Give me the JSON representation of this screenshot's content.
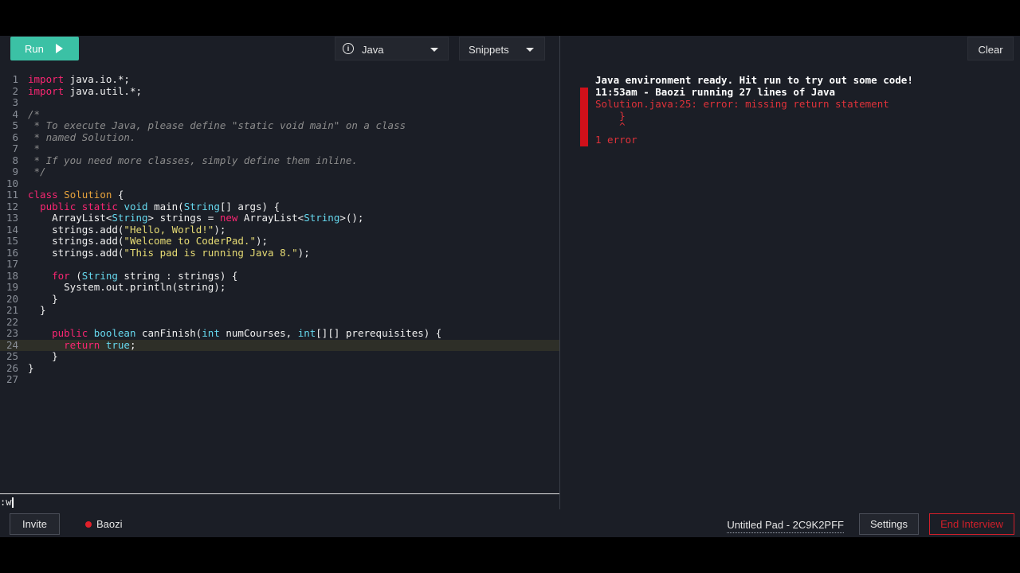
{
  "toolbar": {
    "run_label": "Run",
    "language_label": "Java",
    "snippets_label": "Snippets",
    "clear_label": "Clear"
  },
  "editor": {
    "lines": [
      {
        "n": "1",
        "tokens": [
          {
            "t": "import",
            "c": "kw"
          },
          {
            "t": " java.io.*;"
          }
        ]
      },
      {
        "n": "2",
        "tokens": [
          {
            "t": "import",
            "c": "kw"
          },
          {
            "t": " java.util.*;"
          }
        ]
      },
      {
        "n": "3",
        "tokens": []
      },
      {
        "n": "4",
        "tokens": [
          {
            "t": "/*",
            "c": "cm"
          }
        ]
      },
      {
        "n": "5",
        "tokens": [
          {
            "t": " * To execute Java, please define \"static void main\" on a class",
            "c": "cm"
          }
        ]
      },
      {
        "n": "6",
        "tokens": [
          {
            "t": " * named Solution.",
            "c": "cm"
          }
        ]
      },
      {
        "n": "7",
        "tokens": [
          {
            "t": " *",
            "c": "cm"
          }
        ]
      },
      {
        "n": "8",
        "tokens": [
          {
            "t": " * If you need more classes, simply define them inline.",
            "c": "cm"
          }
        ]
      },
      {
        "n": "9",
        "tokens": [
          {
            "t": " */",
            "c": "cm"
          }
        ]
      },
      {
        "n": "10",
        "tokens": []
      },
      {
        "n": "11",
        "tokens": [
          {
            "t": "class",
            "c": "kw"
          },
          {
            "t": " "
          },
          {
            "t": "Solution",
            "c": "cls"
          },
          {
            "t": " {"
          }
        ]
      },
      {
        "n": "12",
        "tokens": [
          {
            "t": "  "
          },
          {
            "t": "public static",
            "c": "kw"
          },
          {
            "t": " "
          },
          {
            "t": "void",
            "c": "ty"
          },
          {
            "t": " main("
          },
          {
            "t": "String",
            "c": "ty"
          },
          {
            "t": "[] args) {"
          }
        ]
      },
      {
        "n": "13",
        "tokens": [
          {
            "t": "    ArrayList<"
          },
          {
            "t": "String",
            "c": "ty"
          },
          {
            "t": "> strings = "
          },
          {
            "t": "new",
            "c": "kw"
          },
          {
            "t": " ArrayList<"
          },
          {
            "t": "String",
            "c": "ty"
          },
          {
            "t": ">();"
          }
        ]
      },
      {
        "n": "14",
        "tokens": [
          {
            "t": "    strings.add("
          },
          {
            "t": "\"Hello, World!\"",
            "c": "str"
          },
          {
            "t": ");"
          }
        ]
      },
      {
        "n": "15",
        "tokens": [
          {
            "t": "    strings.add("
          },
          {
            "t": "\"Welcome to CoderPad.\"",
            "c": "str"
          },
          {
            "t": ");"
          }
        ]
      },
      {
        "n": "16",
        "tokens": [
          {
            "t": "    strings.add("
          },
          {
            "t": "\"This pad is running Java 8.\"",
            "c": "str"
          },
          {
            "t": ");"
          }
        ]
      },
      {
        "n": "17",
        "tokens": []
      },
      {
        "n": "18",
        "tokens": [
          {
            "t": "    "
          },
          {
            "t": "for",
            "c": "kw"
          },
          {
            "t": " ("
          },
          {
            "t": "String",
            "c": "ty"
          },
          {
            "t": " string : strings) {"
          }
        ]
      },
      {
        "n": "19",
        "tokens": [
          {
            "t": "      System.out.println(string);"
          }
        ]
      },
      {
        "n": "20",
        "tokens": [
          {
            "t": "    }"
          }
        ]
      },
      {
        "n": "21",
        "tokens": [
          {
            "t": "  }"
          }
        ]
      },
      {
        "n": "22",
        "tokens": []
      },
      {
        "n": "23",
        "tokens": [
          {
            "t": "    "
          },
          {
            "t": "public",
            "c": "kw"
          },
          {
            "t": " "
          },
          {
            "t": "boolean",
            "c": "ty"
          },
          {
            "t": " canFinish("
          },
          {
            "t": "int",
            "c": "ty"
          },
          {
            "t": " numCourses, "
          },
          {
            "t": "int",
            "c": "ty"
          },
          {
            "t": "[][] prerequisites) {"
          }
        ]
      },
      {
        "n": "24",
        "active": true,
        "tokens": [
          {
            "t": "      "
          },
          {
            "t": "return",
            "c": "kw"
          },
          {
            "t": " "
          },
          {
            "t": "true",
            "c": "ty"
          },
          {
            "t": ";"
          }
        ]
      },
      {
        "n": "25",
        "tokens": [
          {
            "t": "    }"
          }
        ]
      },
      {
        "n": "26",
        "tokens": [
          {
            "t": "}"
          }
        ]
      },
      {
        "n": "27",
        "tokens": []
      }
    ],
    "command_line": ":w"
  },
  "console": {
    "ready": "Java environment ready. Hit run to try out some code!",
    "run_header": "11:53am - Baozi running 27 lines of Java",
    "error_line": "Solution.java:25: error: missing return statement",
    "error_brace": "    }",
    "error_caret": "    ^",
    "error_count": "1 error"
  },
  "statusbar": {
    "invite_label": "Invite",
    "user_name": "Baozi",
    "pad_name": "Untitled Pad - 2C9K2PFF",
    "settings_label": "Settings",
    "end_label": "End Interview"
  },
  "colors": {
    "run_button": "#3bc1a5",
    "error": "#e0323a",
    "end_interview": "#d11f2a",
    "background": "#1b1e26"
  }
}
